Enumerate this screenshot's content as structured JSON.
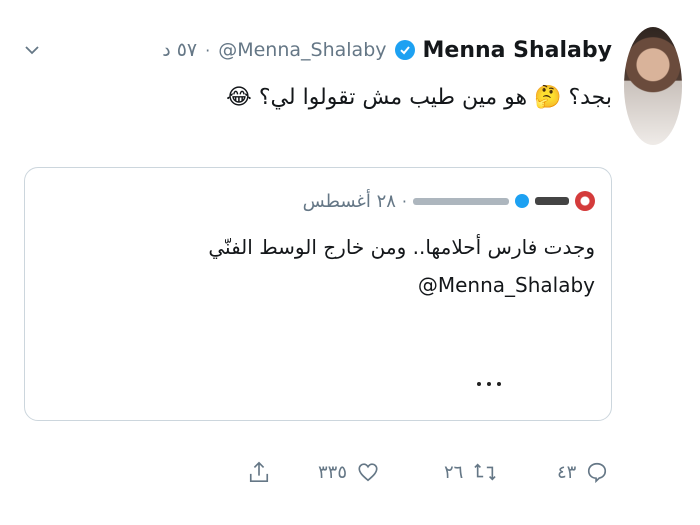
{
  "tweet": {
    "author_name": "Menna Shalaby",
    "handle": "@Menna_Shalaby",
    "time": "٥٧ د",
    "text": "بجد؟ 🤔 هو مين طيب مش تقولوا لي؟ 😂",
    "icons": {
      "verified": "verified-icon",
      "menu": "chevron-down-icon"
    }
  },
  "quote": {
    "date": "٢٨ أغسطس",
    "line1": "وجدت فارس أحلامها.. ومن خارج الوسط الفنّي",
    "mention": "@Menna_Shalaby",
    "avatar_color": "#d43b3b"
  },
  "actions": {
    "reply_count": "٤٣",
    "retweet_count": "٢٦",
    "like_count": "٣٣٥",
    "icons": [
      "reply-icon",
      "retweet-icon",
      "like-icon",
      "share-icon"
    ]
  },
  "colors": {
    "accent": "#1da1f2",
    "muted": "#657786",
    "text": "#14171a",
    "border": "#ccd6dd"
  }
}
